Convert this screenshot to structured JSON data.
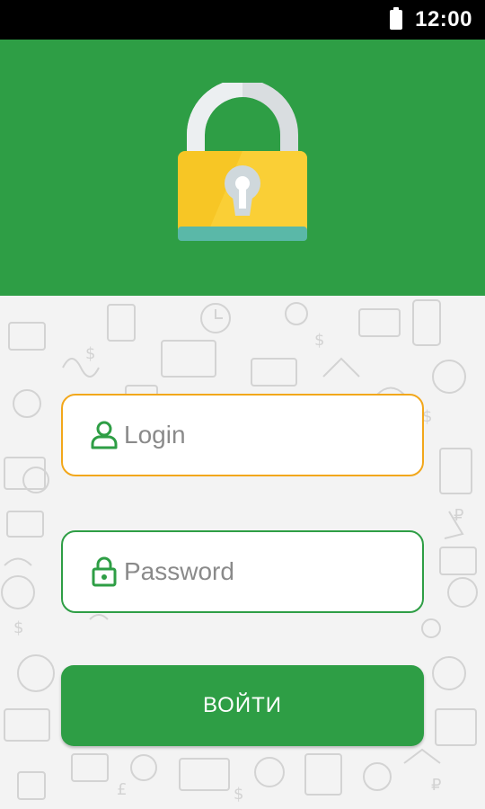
{
  "status_bar": {
    "time": "12:00",
    "battery_icon": "battery-full-icon"
  },
  "header": {
    "illustration": "padlock-icon",
    "background_color": "#2e9e45"
  },
  "form": {
    "login": {
      "placeholder": "Login",
      "value": "",
      "icon": "user-icon",
      "border_color": "#f2a71b"
    },
    "password": {
      "placeholder": "Password",
      "value": "",
      "icon": "lock-icon",
      "border_color": "#2e9e45"
    },
    "submit_label": "ВОЙТИ"
  },
  "colors": {
    "accent": "#2e9e45",
    "focus": "#f2a71b"
  }
}
